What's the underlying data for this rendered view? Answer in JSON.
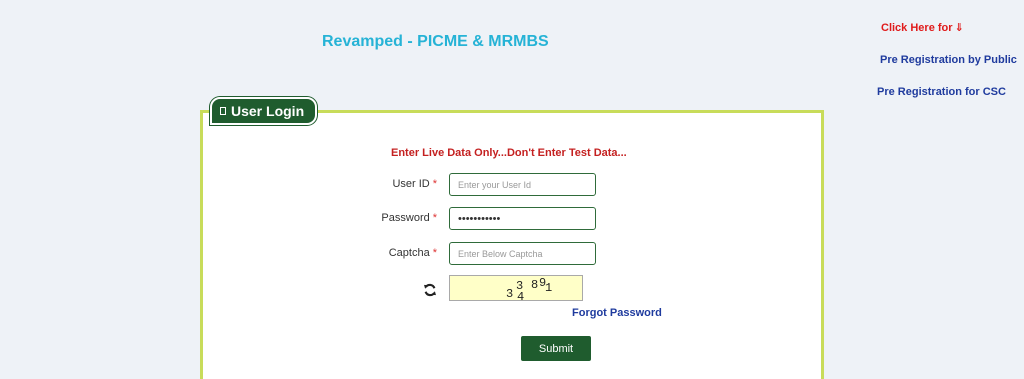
{
  "header": {
    "app_title": "Revamped - PICME & MRMBS"
  },
  "side_links": {
    "click_here": "Click Here for",
    "click_here_arrow": "⇓",
    "pre_reg_public": "Pre Registration by Public",
    "pre_reg_csc": "Pre Registration for CSC"
  },
  "login": {
    "tab_title": "User Login",
    "warning": "Enter Live Data Only...Don't Enter Test Data...",
    "user_id": {
      "label": "User ID",
      "required_mark": "*",
      "placeholder": "Enter your User Id",
      "value": ""
    },
    "password": {
      "label": "Password",
      "required_mark": "*",
      "value": "•••••••••••"
    },
    "captcha": {
      "label": "Captcha",
      "required_mark": "*",
      "placeholder": "Enter Below Captcha",
      "value": "",
      "image_chars": [
        "3",
        "3",
        "4",
        "8",
        "9",
        "1"
      ],
      "refresh_icon": "refresh-icon"
    },
    "forgot_password": "Forgot Password",
    "submit_label": "Submit"
  },
  "colors": {
    "page_bg": "#eef2f7",
    "accent_green": "#1f5c2e",
    "panel_border": "#c8dc5a",
    "title_cyan": "#26b3d6",
    "link_blue": "#1f3b9e",
    "alert_red": "#c42020"
  }
}
